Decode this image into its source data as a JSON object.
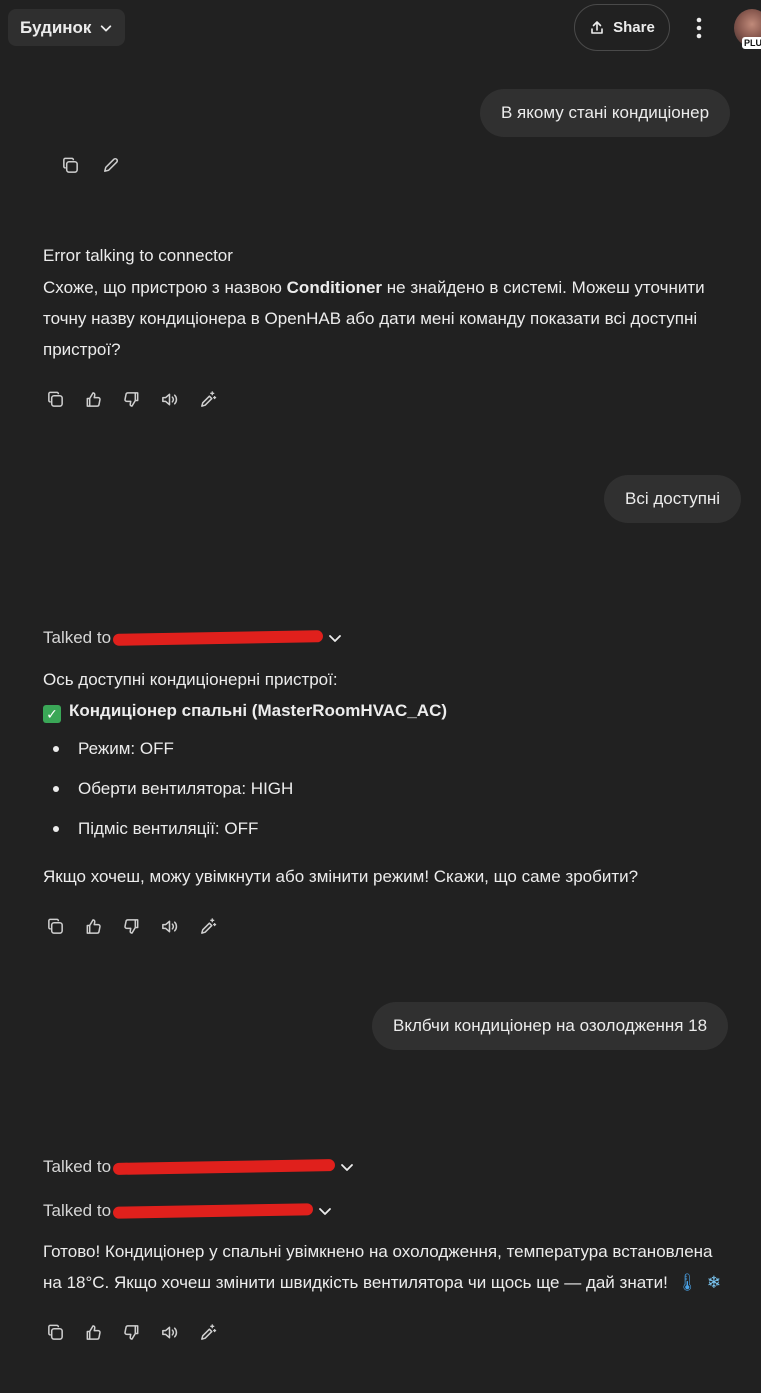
{
  "header": {
    "model_label": "Будинок",
    "share_label": "Share",
    "avatar_badge": "PLU"
  },
  "messages": [
    {
      "role": "user",
      "text": "В якому стані кондиціонер"
    },
    {
      "role": "assistant",
      "status": "Error talking to connector",
      "body_pre": "Схоже, що пристрою з назвою ",
      "body_bold": "Conditioner",
      "body_post": " не знайдено в системі. Можеш уточнити точну назву кондиціонера в OpenHAB або дати мені команду показати всі доступні пристрої?"
    },
    {
      "role": "user",
      "text": "Всі доступні"
    },
    {
      "role": "assistant",
      "tool": "Talked to",
      "intro": "Ось доступні кондиціонерні пристрої:",
      "device_title": "Кондиціонер спальні (MasterRoomHVAC_AC)",
      "bullets": [
        "Режим: OFF",
        "Оберти вентилятора: HIGH",
        "Підміс вентиляції: OFF"
      ],
      "outro": "Якщо хочеш, можу увімкнути або змінити режим! Скажи, що саме зробити?"
    },
    {
      "role": "user",
      "text": "Вклбчи кондиціонер на озолодження 18"
    },
    {
      "role": "assistant",
      "tool_1": "Talked to",
      "tool_2": "Talked to",
      "body": "Готово! Кондиціонер у спальні увімкнено на охолодження, температура встановлена на 18°C. Якщо хочеш змінити швидкість вентилятора чи щось ще — дай знати!",
      "emoji_1": "🌡",
      "emoji_2": "❄"
    }
  ],
  "icons": {
    "copy": "copy-icon",
    "edit": "pencil-icon",
    "like": "thumbs-up-icon",
    "dislike": "thumbs-down-icon",
    "read_aloud": "speaker-icon",
    "edit_response": "magic-pencil-icon"
  }
}
